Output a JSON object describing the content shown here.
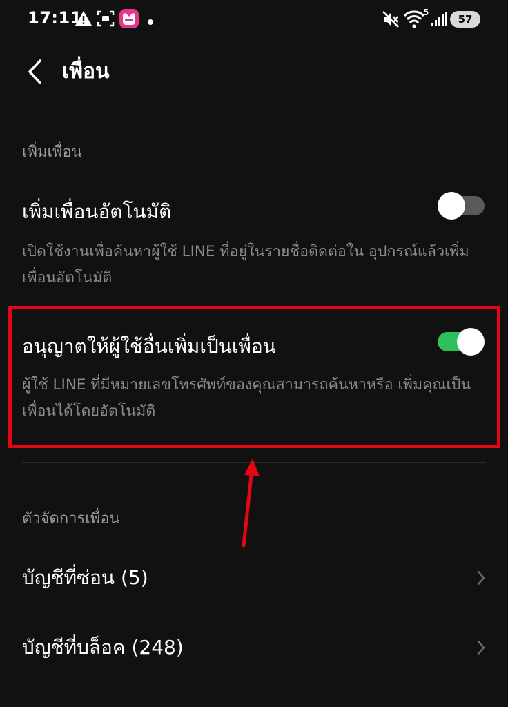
{
  "status_bar": {
    "time": "17:11",
    "notification_icons": [
      "warning-icon",
      "screen-record-icon",
      "lazada-app-icon",
      "dot-icon"
    ],
    "system_icons": [
      "mute-icon",
      "wifi-icon",
      "signal-icon"
    ],
    "wifi_superscript": "5",
    "battery_level": "57"
  },
  "header": {
    "title": "เพื่อน"
  },
  "sections": {
    "add_friends": {
      "header": "เพิ่มเพื่อน",
      "auto_add": {
        "title": "เพิ่มเพื่อนอัตโนมัติ",
        "description": "เปิดใช้งานเพื่อค้นหาผู้ใช้ LINE ที่อยู่ในรายชื่อติดต่อใน อุปกรณ์แล้วเพิ่มเพื่อนอัตโนมัติ",
        "enabled": false
      },
      "allow_others": {
        "title": "อนุญาตให้ผู้ใช้อื่นเพิ่มเป็นเพื่อน",
        "description": "ผู้ใช้ LINE ที่มีหมายเลขโทรศัพท์ของคุณสามารถค้นหาหรือ เพิ่มคุณเป็นเพื่อนได้โดยอัตโนมัติ",
        "enabled": true
      }
    },
    "friend_manager": {
      "header": "ตัวจัดการเพื่อน",
      "items": [
        {
          "label": "บัญชีที่ซ่อน (5)"
        },
        {
          "label": "บัญชีที่บล็อค (248)"
        }
      ]
    }
  },
  "colors": {
    "background": "#111111",
    "toggle_on": "#2fbf5c",
    "toggle_off": "#5a5a5a",
    "annotation": "#e30613"
  }
}
